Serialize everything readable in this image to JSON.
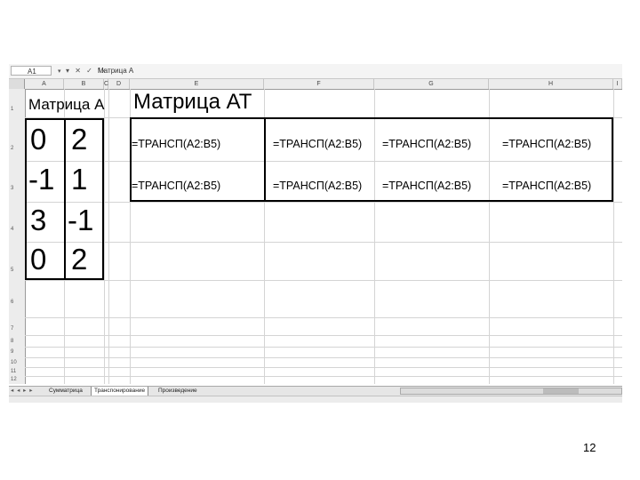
{
  "formula_bar": {
    "cell_ref": "A1",
    "icons": "▾ ✕ ✓ fx",
    "content": "Матрица А"
  },
  "columns": [
    "A",
    "B",
    "C",
    "D",
    "E",
    "F",
    "G",
    "H",
    "I"
  ],
  "rows": [
    "1",
    "2",
    "3",
    "4",
    "5",
    "6",
    "7",
    "8",
    "9",
    "10",
    "11",
    "12"
  ],
  "titles": {
    "matrix_a": "Матрица А",
    "matrix_at": "Матрица АТ"
  },
  "matrix_a": [
    [
      "0",
      "2"
    ],
    [
      "-1",
      "1"
    ],
    [
      "3",
      "-1"
    ],
    [
      "0",
      "2"
    ]
  ],
  "matrix_at_formulas": [
    [
      "=ТРАНСП(A2:B5)",
      "=ТРАНСП(A2:B5)",
      "=ТРАНСП(A2:B5)",
      "=ТРАНСП(A2:B5)"
    ],
    [
      "=ТРАНСП(A2:B5)",
      "=ТРАНСП(A2:B5)",
      "=ТРАНСП(A2:B5)",
      "=ТРАНСП(A2:B5)"
    ]
  ],
  "sheet_tabs": {
    "nav": "◂ ◂ ▸ ▸",
    "tabs": [
      "Сумматрица",
      "Транспонирование",
      "Произведение"
    ]
  },
  "page_number": "12"
}
